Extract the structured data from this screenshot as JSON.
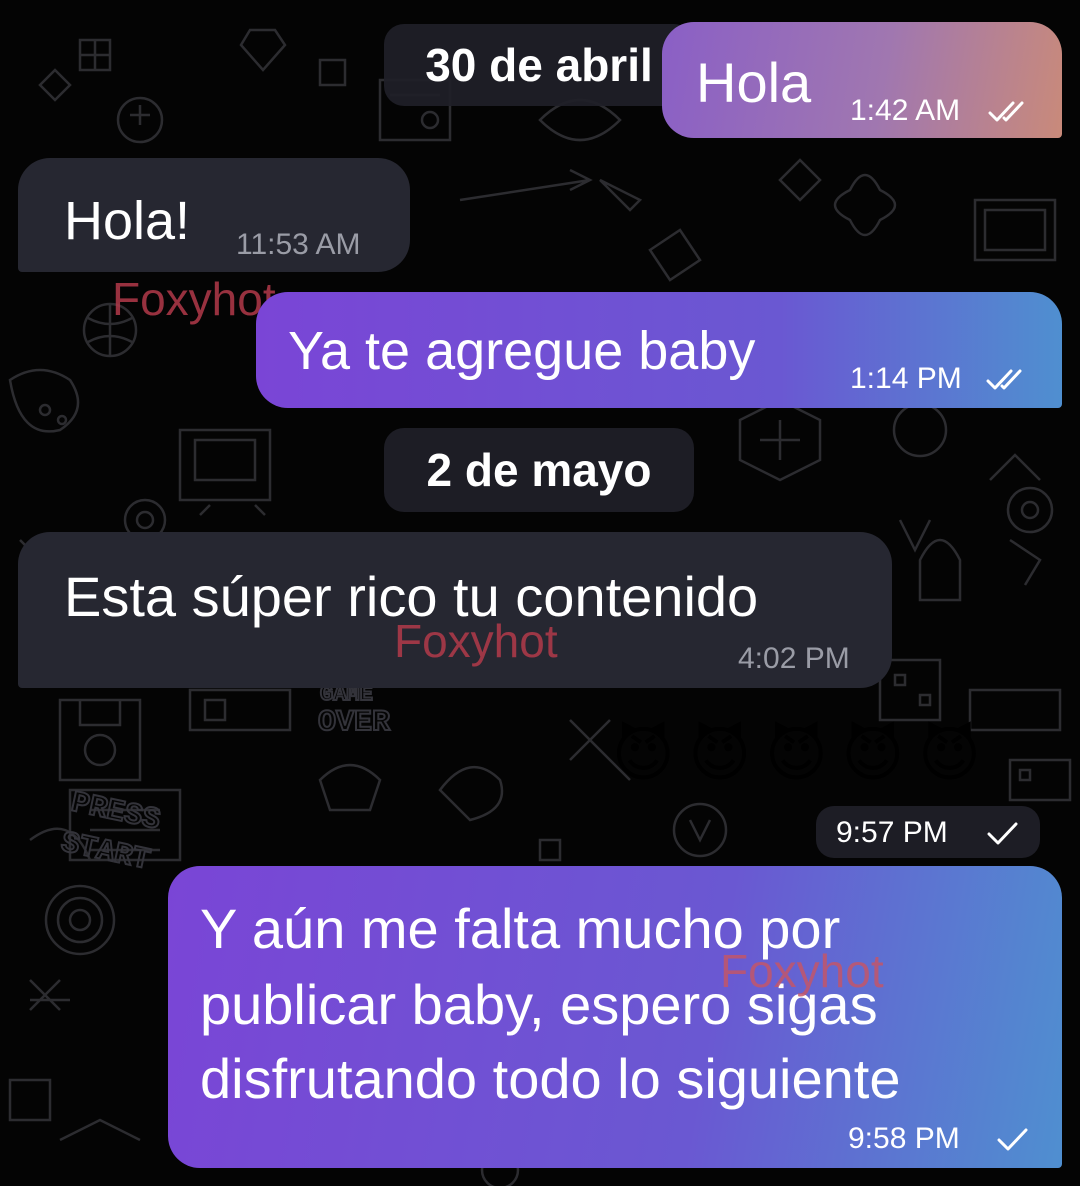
{
  "colors": {
    "background": "#040404",
    "incoming_bubble": "#262731",
    "outgoing_gradient_start": "#7a45d6",
    "outgoing_gradient_end": "#4f8fd0",
    "first_bubble_gradient_start": "#8a5fc6",
    "first_bubble_gradient_end": "#c98a7a",
    "watermark": "#b23a4a"
  },
  "dates": {
    "first": "30 de abril",
    "second": "2 de mayo"
  },
  "messages": {
    "m1": {
      "text": "Hola",
      "time": "1:42 AM",
      "status": "read-double-check-icon"
    },
    "m2": {
      "text": "Hola!",
      "time": "11:53 AM"
    },
    "m3": {
      "text": "Ya te agregue baby",
      "time": "1:14 PM",
      "status": "read-double-check-icon"
    },
    "m4": {
      "text": "Esta súper rico tu contenido",
      "time": "4:02 PM"
    },
    "m5": {
      "emoji": "😈😈😈😈😈",
      "time": "9:57 PM",
      "status": "sent-check-icon"
    },
    "m6": {
      "line1": "Y aún me falta mucho por",
      "line2": "publicar baby, espero sigas",
      "line3": "disfrutando todo lo siguiente",
      "time": "9:58 PM",
      "status": "sent-check-icon"
    }
  },
  "watermarks": {
    "w1": "Foxyhot",
    "w2": "Foxyhot",
    "w3": "Foxyhot"
  }
}
